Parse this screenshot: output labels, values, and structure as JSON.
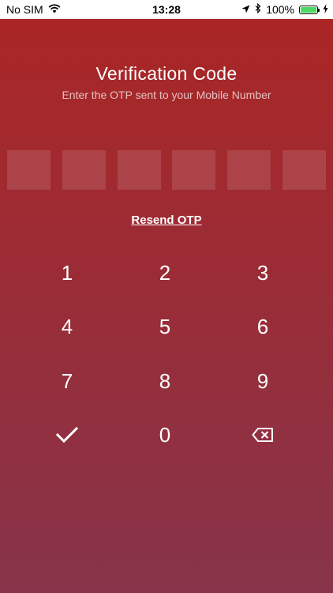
{
  "status_bar": {
    "carrier": "No SIM",
    "time": "13:28",
    "battery": "100%",
    "battery_level": 1.0,
    "battery_color": "#4cd964"
  },
  "screen": {
    "title": "Verification Code",
    "subtitle": "Enter the OTP sent to your Mobile Number",
    "otp_digits": [
      "",
      "",
      "",
      "",
      "",
      ""
    ],
    "resend_label": "Resend OTP",
    "gradient_top": "#aa2626",
    "gradient_bottom": "#87344a"
  },
  "keypad": {
    "keys": [
      "1",
      "2",
      "3",
      "4",
      "5",
      "6",
      "7",
      "8",
      "9"
    ],
    "zero": "0",
    "confirm_icon": "checkmark-icon",
    "delete_icon": "backspace-icon"
  }
}
